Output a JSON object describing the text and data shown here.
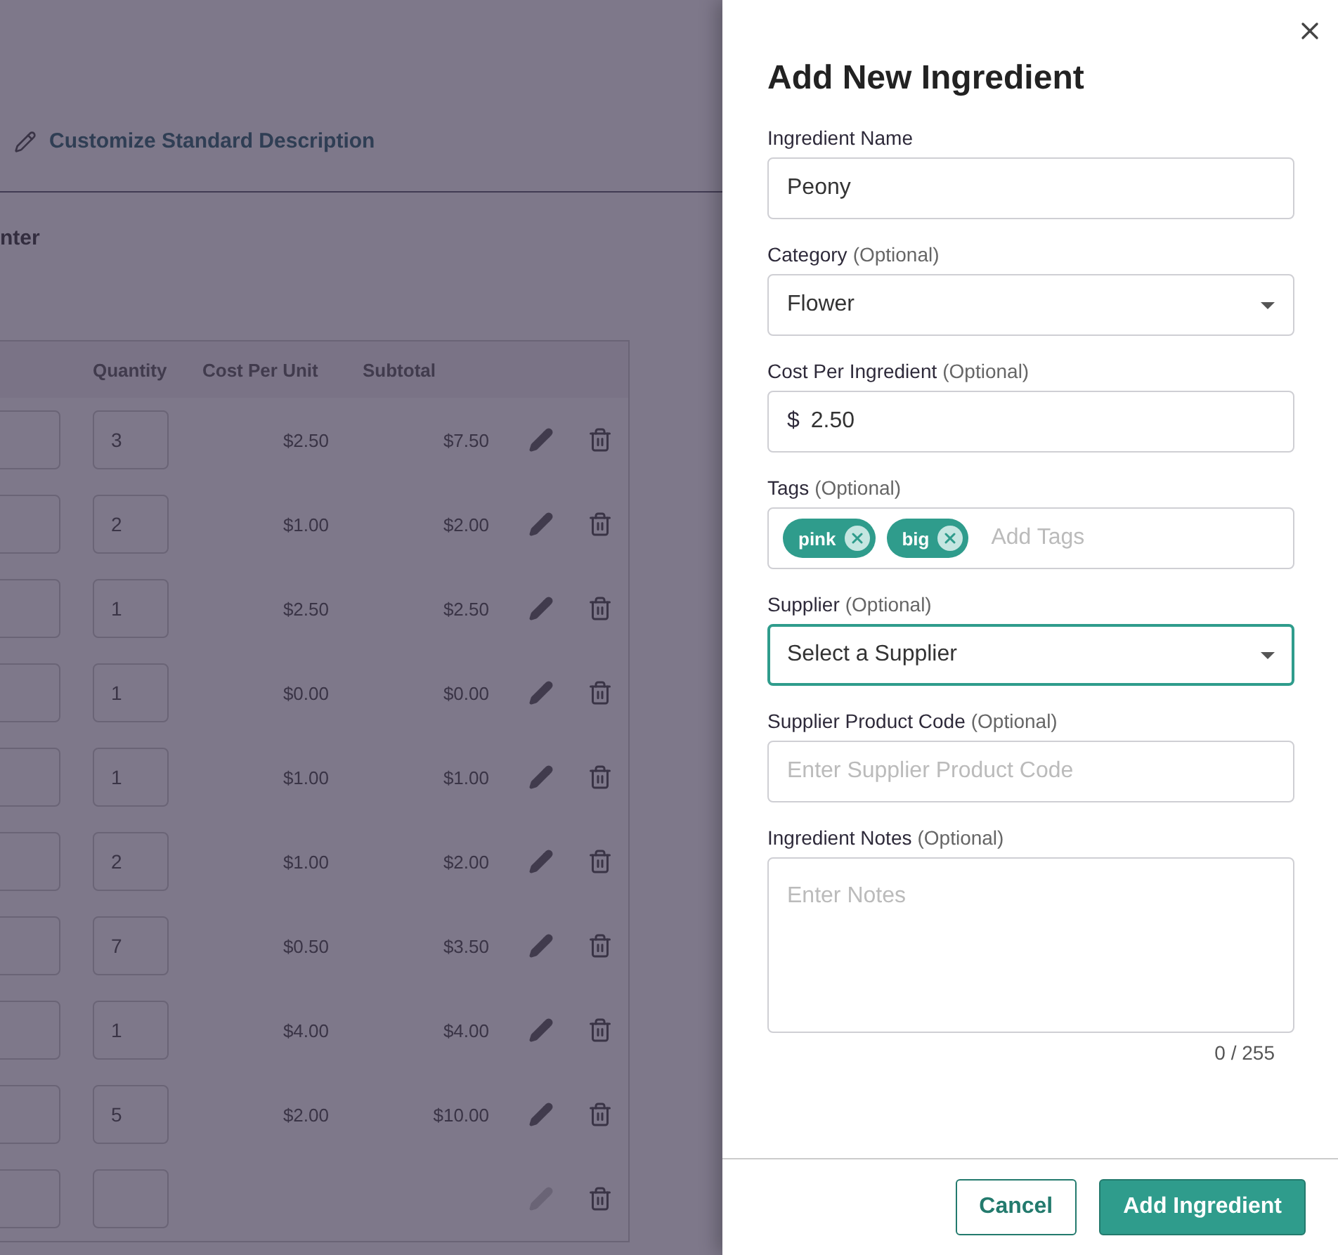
{
  "background": {
    "customize_link": "Customize Standard Description",
    "section_heading": "nter",
    "table": {
      "columns": [
        "Quantity",
        "Cost Per Unit",
        "Subtotal"
      ],
      "rows": [
        {
          "quantity": "3",
          "cost_per_unit": "$2.50",
          "subtotal": "$7.50",
          "edit_disabled": false
        },
        {
          "quantity": "2",
          "cost_per_unit": "$1.00",
          "subtotal": "$2.00",
          "edit_disabled": false
        },
        {
          "quantity": "1",
          "cost_per_unit": "$2.50",
          "subtotal": "$2.50",
          "edit_disabled": false
        },
        {
          "quantity": "1",
          "cost_per_unit": "$0.00",
          "subtotal": "$0.00",
          "edit_disabled": false
        },
        {
          "quantity": "1",
          "cost_per_unit": "$1.00",
          "subtotal": "$1.00",
          "edit_disabled": false
        },
        {
          "quantity": "2",
          "cost_per_unit": "$1.00",
          "subtotal": "$2.00",
          "edit_disabled": false
        },
        {
          "quantity": "7",
          "cost_per_unit": "$0.50",
          "subtotal": "$3.50",
          "edit_disabled": false
        },
        {
          "quantity": "1",
          "cost_per_unit": "$4.00",
          "subtotal": "$4.00",
          "edit_disabled": false
        },
        {
          "quantity": "5",
          "cost_per_unit": "$2.00",
          "subtotal": "$10.00",
          "edit_disabled": false
        },
        {
          "edit_disabled": true
        }
      ]
    }
  },
  "drawer": {
    "title": "Add New Ingredient",
    "fields": [
      {
        "kind": "text",
        "label": "Ingredient Name",
        "value": "Peony",
        "focused": false
      },
      {
        "kind": "select",
        "label": "Category",
        "optional": "(Optional)",
        "value": "Flower",
        "focused": false
      },
      {
        "kind": "currency",
        "label": "Cost Per Ingredient",
        "optional": "(Optional)",
        "prefix": "$",
        "value": "2.50",
        "focused": false
      },
      {
        "kind": "tags",
        "label": "Tags",
        "optional": "(Optional)",
        "tags": [
          "pink",
          "big"
        ],
        "placeholder": "Add Tags",
        "focused": false
      },
      {
        "kind": "select",
        "label": "Supplier",
        "optional": "(Optional)",
        "value": "Select a Supplier",
        "focused": true
      },
      {
        "kind": "text",
        "label": "Supplier Product Code",
        "optional": "(Optional)",
        "placeholder": "Enter Supplier Product Code",
        "focused": false
      },
      {
        "kind": "textarea",
        "label": "Ingredient Notes",
        "optional": "(Optional)",
        "placeholder": "Enter Notes",
        "counter": "0 / 255",
        "focused": false
      }
    ],
    "buttons": [
      {
        "kind": "secondary",
        "label": "Cancel"
      },
      {
        "kind": "primary",
        "label": "Add Ingredient"
      }
    ]
  }
}
